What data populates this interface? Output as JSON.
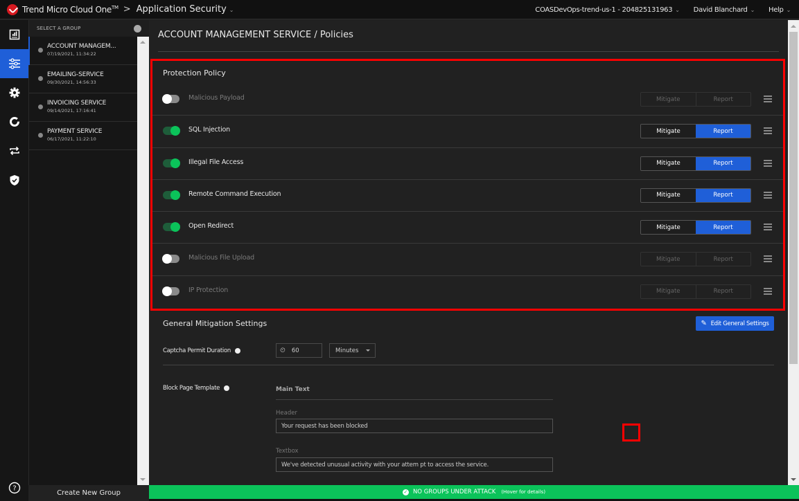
{
  "topbar": {
    "brand": "Trend Micro Cloud One",
    "brand_tm": "TM",
    "separator": ">",
    "app_name": "Application Security",
    "account": "COASDevOps-trend-us-1 - 204825131963",
    "user": "David Blanchard",
    "help": "Help",
    "chevron": "⌄"
  },
  "iconrail": {
    "items": [
      {
        "name": "reports-icon",
        "active": false
      },
      {
        "name": "policies-icon",
        "active": true
      },
      {
        "name": "settings-icon",
        "active": false
      },
      {
        "name": "status-icon",
        "active": false
      },
      {
        "name": "transfer-icon",
        "active": false
      },
      {
        "name": "shield-icon",
        "active": false
      }
    ],
    "help_glyph": "?"
  },
  "groups": {
    "header": "SELECT A GROUP",
    "items": [
      {
        "name": "ACCOUNT MANAGEM...",
        "date": "07/19/2021, 11:34:22",
        "active": true
      },
      {
        "name": "EMAILING-SERVICE",
        "date": "09/30/2021, 14:56:33",
        "active": false
      },
      {
        "name": "INVOICING SERVICE",
        "date": "09/14/2021, 17:16:41",
        "active": false
      },
      {
        "name": "PAYMENT SERVICE",
        "date": "06/17/2021, 11:22:10",
        "active": false
      }
    ],
    "create_label": "Create New Group"
  },
  "main": {
    "title": "ACCOUNT MANAGEMENT SERVICE / Policies",
    "protection_policy": {
      "title": "Protection Policy",
      "mitigate_label": "Mitigate",
      "report_label": "Report",
      "policies": [
        {
          "name": "Malicious Payload",
          "enabled": false,
          "mode": null
        },
        {
          "name": "SQL Injection",
          "enabled": true,
          "mode": "Report"
        },
        {
          "name": "Illegal File Access",
          "enabled": true,
          "mode": "Report"
        },
        {
          "name": "Remote Command Execution",
          "enabled": true,
          "mode": "Report"
        },
        {
          "name": "Open Redirect",
          "enabled": true,
          "mode": "Report"
        },
        {
          "name": "Malicious File Upload",
          "enabled": false,
          "mode": null
        },
        {
          "name": "IP Protection",
          "enabled": false,
          "mode": null
        }
      ]
    },
    "general_mitigation": {
      "title": "General Mitigation Settings",
      "edit_button": "Edit General Settings",
      "captcha_label": "Captcha Permit Duration",
      "captcha_value": "60",
      "captcha_unit": "Minutes",
      "block_page_label": "Block Page Template",
      "main_text_heading": "Main Text",
      "header_label": "Header",
      "header_value": "Your request has been blocked",
      "textbox_label": "Textbox",
      "textbox_value": "We've detected unusual activity with your attem pt to access the service."
    }
  },
  "status": {
    "text": "NO GROUPS UNDER ATTACK",
    "hint": "(Hover for details)",
    "color": "#0bc35a"
  },
  "colors": {
    "accent": "#1f5fd8",
    "toggle_on": "#0bc35a",
    "highlight": "#ff0000"
  }
}
